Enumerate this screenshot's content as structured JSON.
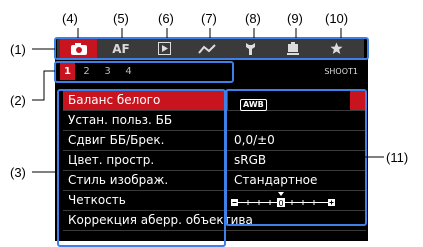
{
  "callouts": {
    "c1": "(1)",
    "c2": "(2)",
    "c3": "(3)",
    "c4": "(4)",
    "c5": "(5)",
    "c6": "(6)",
    "c7": "(7)",
    "c8": "(8)",
    "c9": "(9)",
    "c10": "(10)",
    "c11": "(11)"
  },
  "tabs": [
    {
      "icon": "camera-icon"
    },
    {
      "label": "AF"
    },
    {
      "icon": "playback-icon"
    },
    {
      "icon": "wireless-icon"
    },
    {
      "icon": "wrench-icon"
    },
    {
      "icon": "custom-icon"
    },
    {
      "icon": "star-icon"
    }
  ],
  "pages": [
    "1",
    "2",
    "3",
    "4"
  ],
  "tab_title": "SHOOT1",
  "menu": [
    {
      "label": "Баланс белого",
      "value": "AWB"
    },
    {
      "label": "Устан. польз. ББ",
      "value": ""
    },
    {
      "label": "Сдвиг ББ/Брек.",
      "value": "0,0/±0"
    },
    {
      "label": "Цвет. простр.",
      "value": "sRGB"
    },
    {
      "label": "Стиль изображ.",
      "value": "Стандартное"
    },
    {
      "label": "Четкость",
      "value": ""
    },
    {
      "label": "Коррекция аберр. объектива",
      "value": ""
    }
  ],
  "colors": {
    "accent": "#c8141e",
    "callout_box": "#3f7fe8"
  }
}
